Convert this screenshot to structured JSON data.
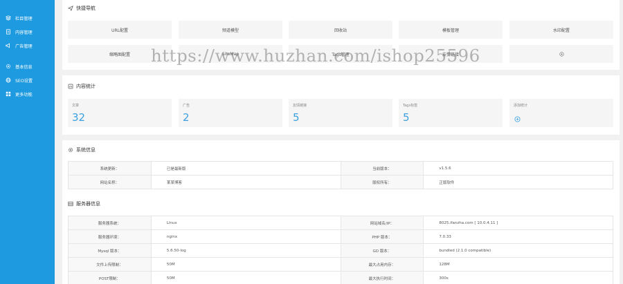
{
  "sidebar": {
    "items": [
      {
        "label": "栏目管理",
        "icon": "layers-icon"
      },
      {
        "label": "内容管理",
        "icon": "document-icon"
      },
      {
        "label": "广告管理",
        "icon": "ad-icon"
      },
      {
        "label": "基本信息",
        "icon": "gear-icon"
      },
      {
        "label": "SEO设置",
        "icon": "globe-icon"
      },
      {
        "label": "更多功能",
        "icon": "grid-icon"
      }
    ]
  },
  "quick_nav": {
    "title": "快捷导航",
    "buttons": [
      "URL配置",
      "频道模型",
      "回收站",
      "模板管理",
      "水印配置",
      "缩略图配置",
      "SiteMap",
      "Tags管理",
      "友情链接"
    ],
    "add_icon": "plus-circle-icon"
  },
  "content_stats": {
    "title": "内容统计",
    "items": [
      {
        "label": "文章",
        "value": "32"
      },
      {
        "label": "广告",
        "value": "2"
      },
      {
        "label": "友情链接",
        "value": "5"
      },
      {
        "label": "Tags标签",
        "value": "5"
      }
    ],
    "add_label": "添加统计"
  },
  "system_info": {
    "title": "系统信息",
    "rows": [
      {
        "k1": "系统更新：",
        "v1": "已是最新版",
        "k2": "当前版本：",
        "v2": "v1.5.6"
      },
      {
        "k1": "网站名称：",
        "v1": "某某博客",
        "k2": "版权所有：",
        "v2": "正版软件"
      }
    ]
  },
  "server_info": {
    "title": "服务器信息",
    "rows": [
      {
        "k1": "服务器系统：",
        "v1": "Linux",
        "k2": "网站域名/IP：",
        "v2": "8025.ifanzha.com [ 10.0.4.11 ]"
      },
      {
        "k1": "服务器环境：",
        "v1": "nginx",
        "k2": "PHP 版本：",
        "v2": "7.0.33"
      },
      {
        "k1": "Mysql 版本：",
        "v1": "5.6.50-log",
        "k2": "GD 版本：",
        "v2": "bundled (2.1.0 compatible)"
      },
      {
        "k1": "文件上传限制：",
        "v1": "50M",
        "k2": "最大占用内存：",
        "v2": "128M"
      },
      {
        "k1": "POST限制：",
        "v1": "50M",
        "k2": "最大执行时间：",
        "v2": "300s"
      }
    ]
  },
  "watermark": "https://www.huzhan.com/ishop25596"
}
